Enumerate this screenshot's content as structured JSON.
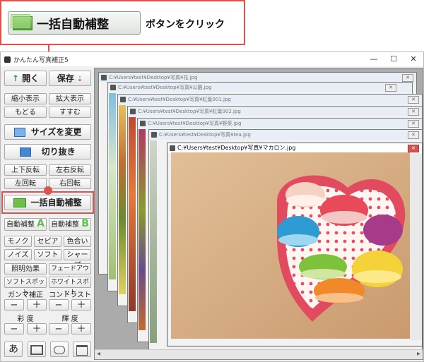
{
  "callout": {
    "button_label": "一括自動補整",
    "text": "ボタンをクリック",
    "accent": "#d9534f"
  },
  "window": {
    "title": "かんたん写真補正5",
    "minimize": "—",
    "maximize": "☐",
    "close": "✕"
  },
  "toolbar": {
    "open": "開く",
    "save": "保存",
    "shrink": "縮小表示",
    "enlarge": "拡大表示",
    "undo": "もどる",
    "redo": "すすむ",
    "resize": "サイズを変更",
    "crop": "切り抜き",
    "flip_v": "上下反転",
    "flip_h": "左右反転",
    "rotate_left": "左回転",
    "rotate_right": "右回転",
    "auto_all": "一括自動補整",
    "auto_a": "自動補整",
    "auto_a_mark": "A",
    "auto_b": "自動補整",
    "auto_b_mark": "B",
    "mono": "モノクロ",
    "sepia": "セピア",
    "color_tone": "色合い",
    "noise": "ノイズ",
    "soft": "ソフト",
    "sharp": "シャープ",
    "lighting": "照明効果",
    "fade_out": "フェードアウト",
    "soft_spot": "ソフトスポット",
    "white_spot": "ホワイトスポット",
    "gamma": "ガンマ補正",
    "contrast": "コントラスト",
    "saturation": "彩 度",
    "brightness": "輝 度",
    "minus": "−",
    "plus": "＋",
    "text_tool": "あ"
  },
  "documents": [
    {
      "title": "C:¥Users¥test¥Desktop¥写真¥花.jpg"
    },
    {
      "title": "C:¥Users¥test¥Desktop¥写真¥公園.jpg"
    },
    {
      "title": "C:¥Users¥test¥Desktop¥写真¥紅葉001.jpg"
    },
    {
      "title": "C:¥Users¥test¥Desktop¥写真¥紅葉002.jpg"
    },
    {
      "title": "C:¥Users¥test¥Desktop¥写真¥野菜.jpg"
    },
    {
      "title": "C:¥Users¥test¥Desktop¥写真¥tea.jpg"
    },
    {
      "title": "C:¥Users¥test¥Desktop¥写真¥マカロン.jpg"
    }
  ],
  "scrollbar": {
    "left": "◂",
    "right": "▸"
  }
}
